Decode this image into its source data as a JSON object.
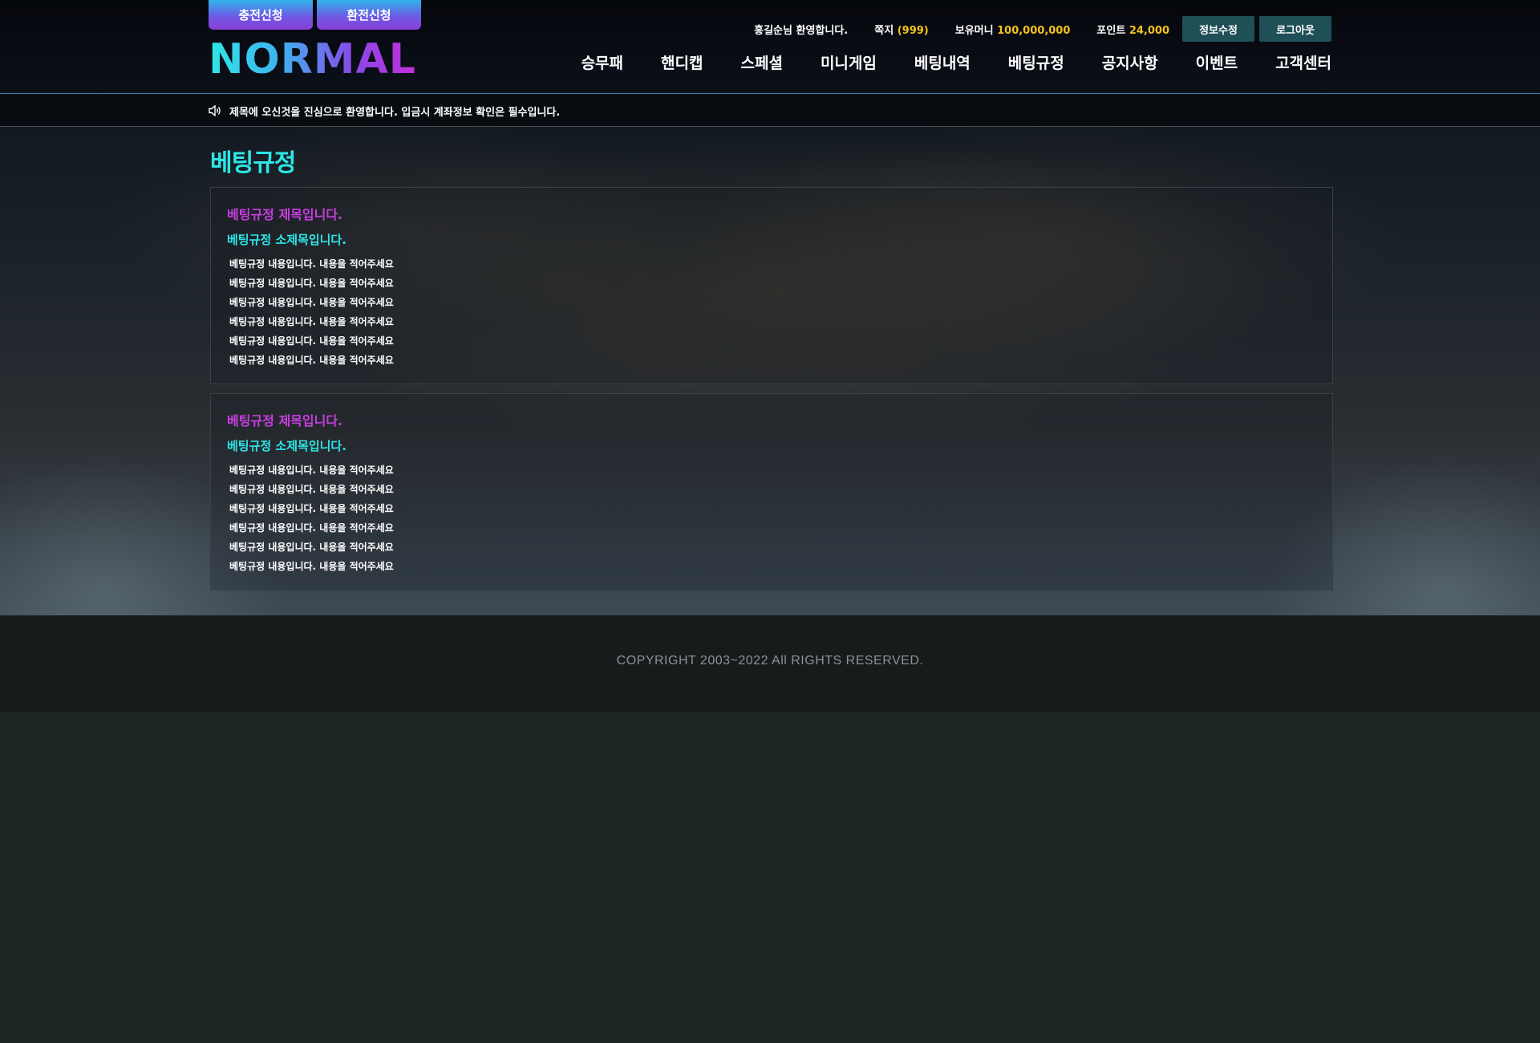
{
  "header": {
    "buttons": {
      "deposit": "충전신청",
      "withdraw": "환전신청"
    },
    "logo": "NORMAL",
    "user": {
      "welcome": "홍길순님 환영합니다.",
      "message_label": "쪽지",
      "message_count": "(999)",
      "money_label": "보유머니",
      "money_value": "100,000,000",
      "point_label": "포인트",
      "point_value": "24,000",
      "edit_label": "정보수정",
      "logout_label": "로그아웃"
    },
    "nav": [
      {
        "label": "승무패"
      },
      {
        "label": "핸디캡"
      },
      {
        "label": "스페셜"
      },
      {
        "label": "미니게임"
      },
      {
        "label": "베팅내역"
      },
      {
        "label": "베팅규정"
      },
      {
        "label": "공지사항"
      },
      {
        "label": "이벤트"
      },
      {
        "label": "고객센터"
      }
    ]
  },
  "notice": {
    "icon": "speaker-icon",
    "text": "제목에 오신것을 진심으로 환영합니다. 입금시 계좌정보 확인은 필수입니다."
  },
  "main": {
    "title": "베팅규정",
    "sections": [
      {
        "title": "베팅규정 제목입니다.",
        "subtitle": "베팅규정 소제목입니다.",
        "lines": [
          "베팅규정 내용입니다. 내용을 적어주세요",
          "베팅규정 내용입니다. 내용을 적어주세요",
          "베팅규정 내용입니다. 내용을 적어주세요",
          "베팅규정 내용입니다. 내용을 적어주세요",
          "베팅규정 내용입니다. 내용을 적어주세요",
          "베팅규정 내용입니다. 내용을 적어주세요"
        ]
      },
      {
        "title": "베팅규정 제목입니다.",
        "subtitle": "베팅규정 소제목입니다.",
        "lines": [
          "베팅규정 내용입니다. 내용을 적어주세요",
          "베팅규정 내용입니다. 내용을 적어주세요",
          "베팅규정 내용입니다. 내용을 적어주세요",
          "베팅규정 내용입니다. 내용을 적어주세요",
          "베팅규정 내용입니다. 내용을 적어주세요",
          "베팅규정 내용입니다. 내용을 적어주세요"
        ]
      }
    ]
  },
  "footer": {
    "copyright": "COPYRIGHT 2003~2022 All RIGHTS RESERVED."
  },
  "colors": {
    "accent_cyan": "#2de6e6",
    "accent_magenta": "#c83fe0",
    "highlight_yellow": "#f3c21b",
    "button_teal": "#1f4f57"
  }
}
